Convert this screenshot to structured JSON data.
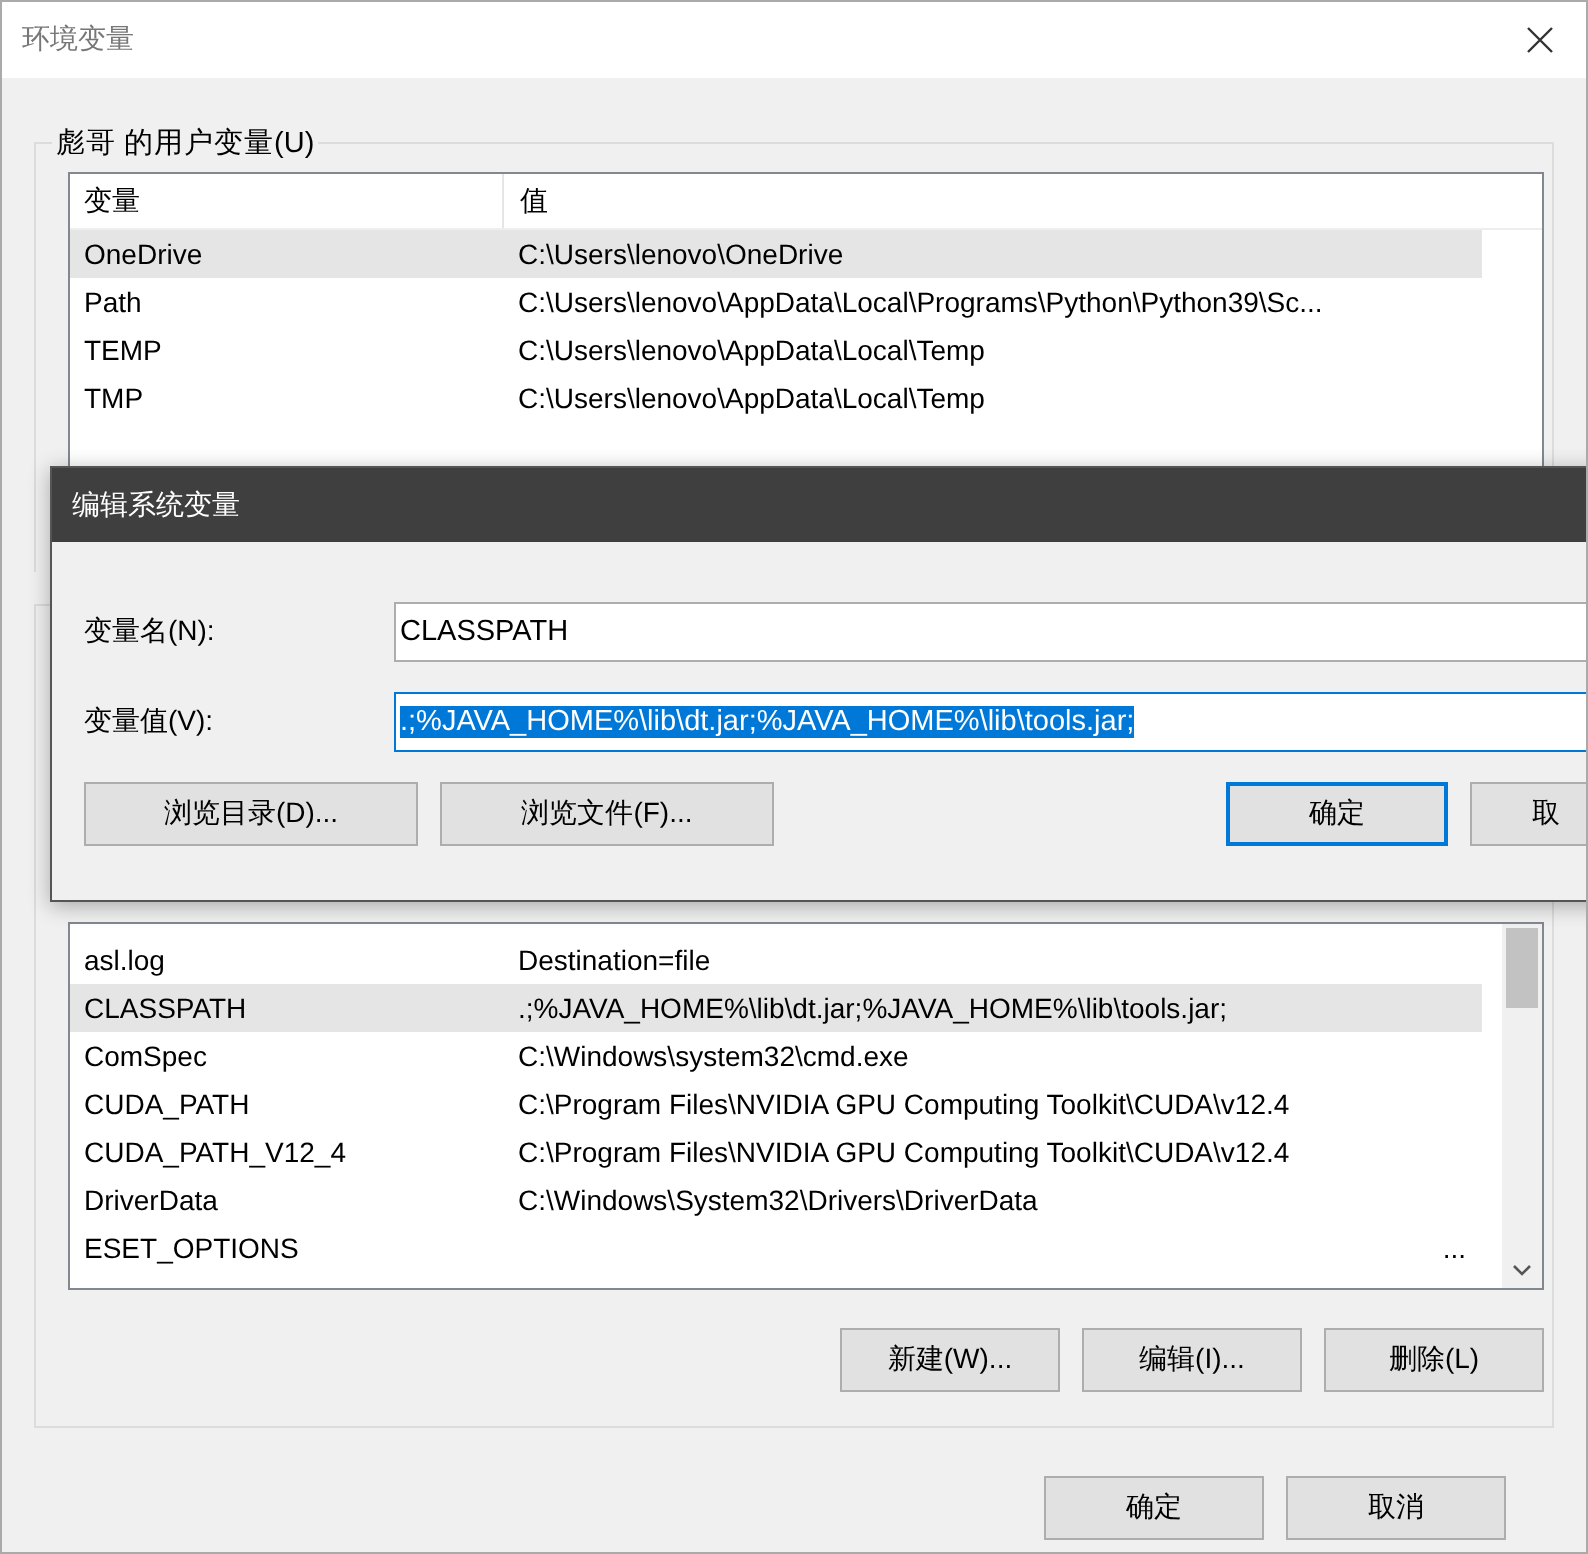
{
  "window": {
    "title": "环境变量"
  },
  "user_variables": {
    "label": "彪哥 的用户变量(U)",
    "columns": [
      "变量",
      "值"
    ],
    "rows": [
      {
        "name": "OneDrive",
        "value": "C:\\Users\\lenovo\\OneDrive",
        "selected": true
      },
      {
        "name": "Path",
        "value": "C:\\Users\\lenovo\\AppData\\Local\\Programs\\Python\\Python39\\Sc...",
        "selected": false
      },
      {
        "name": "TEMP",
        "value": "C:\\Users\\lenovo\\AppData\\Local\\Temp",
        "selected": false
      },
      {
        "name": "TMP",
        "value": "C:\\Users\\lenovo\\AppData\\Local\\Temp",
        "selected": false
      }
    ]
  },
  "system_variables": {
    "rows": [
      {
        "name": "asl.log",
        "value": "Destination=file",
        "selected": false
      },
      {
        "name": "CLASSPATH",
        "value": ".;%JAVA_HOME%\\lib\\dt.jar;%JAVA_HOME%\\lib\\tools.jar;",
        "selected": true
      },
      {
        "name": "ComSpec",
        "value": "C:\\Windows\\system32\\cmd.exe",
        "selected": false
      },
      {
        "name": "CUDA_PATH",
        "value": "C:\\Program Files\\NVIDIA GPU Computing Toolkit\\CUDA\\v12.4",
        "selected": false
      },
      {
        "name": "CUDA_PATH_V12_4",
        "value": "C:\\Program Files\\NVIDIA GPU Computing Toolkit\\CUDA\\v12.4",
        "selected": false
      },
      {
        "name": "DriverData",
        "value": "C:\\Windows\\System32\\Drivers\\DriverData",
        "selected": false
      },
      {
        "name": "ESET_OPTIONS",
        "value": "...",
        "selected": false
      }
    ],
    "buttons": [
      "新建(W)...",
      "编辑(I)...",
      "删除(L)"
    ]
  },
  "buttons": [
    {
      "label": "确定"
    },
    {
      "label": "取消"
    }
  ],
  "edit_dialog": {
    "title": "编辑系统变量",
    "fields": [
      {
        "label": "变量名(N):",
        "value": "CLASSPATH",
        "focused": false
      },
      {
        "label": "变量值(V):",
        "value": ".;%JAVA_HOME%\\lib\\dt.jar;%JAVA_HOME%\\lib\\tools.jar;",
        "focused": true
      }
    ],
    "browse_buttons": [
      "浏览目录(D)...",
      "浏览文件(F)..."
    ],
    "buttons": [
      {
        "label": "确定",
        "default": true
      },
      {
        "label": "取",
        "default": false
      }
    ]
  }
}
